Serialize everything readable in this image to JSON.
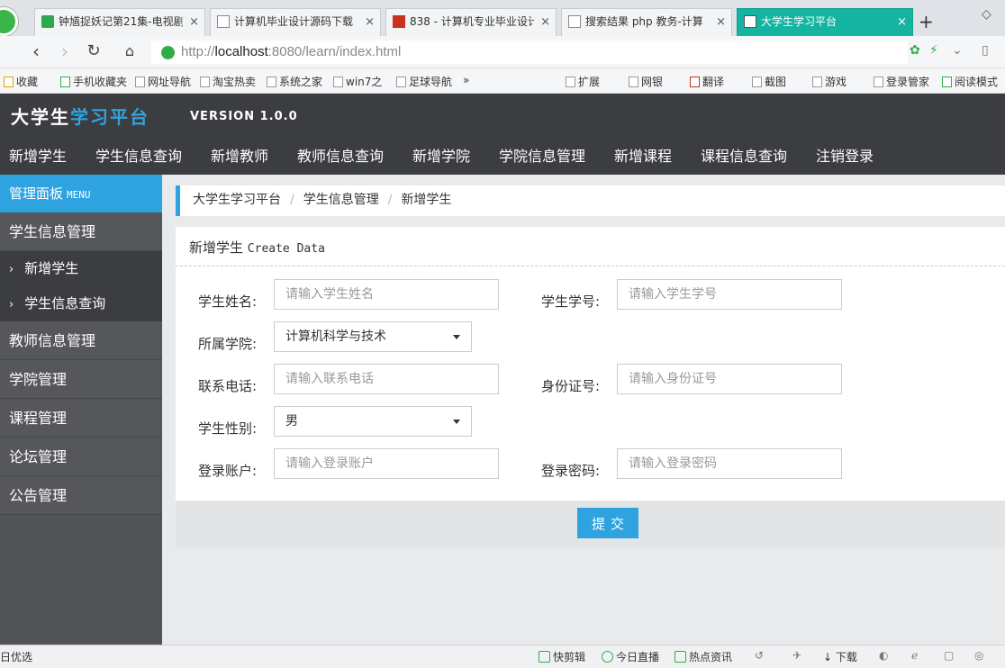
{
  "browser": {
    "tabs": [
      {
        "title": "钟馗捉妖记第21集-电视剧",
        "icon": "video-icon",
        "active": false
      },
      {
        "title": "计算机毕业设计源码下载",
        "icon": "page-icon",
        "active": false
      },
      {
        "title": "838 - 计算机专业毕业设计",
        "icon": "red-icon",
        "active": false
      },
      {
        "title": "搜索结果 php 教务-计算",
        "icon": "page-icon",
        "active": false
      },
      {
        "title": "大学生学习平台",
        "icon": "image-icon",
        "active": true
      }
    ],
    "tab_close": "×",
    "new_tab": "+",
    "url_prefix": "http://",
    "url_host": "localhost",
    "url_rest": ":8080/learn/index.html",
    "bookmarks": [
      "收藏",
      "手机收藏夹",
      "网址导航",
      "淘宝热卖",
      "系统之家",
      "win7之",
      "足球导航"
    ],
    "bookmarks_more": "»",
    "toolbar_right": [
      "扩展",
      "网银",
      "翻译",
      "截图",
      "游戏",
      "登录管家",
      "阅读模式"
    ],
    "status_left": "日优选",
    "status_right": [
      "快剪辑",
      "今日直播",
      "热点资讯",
      "下载"
    ]
  },
  "app": {
    "logo_main": "大学生",
    "logo_accent": "学习平台",
    "version": "VERSION 1.0.0",
    "top_nav": [
      "新增学生",
      "学生信息查询",
      "新增教师",
      "教师信息查询",
      "新增学院",
      "学院信息管理",
      "新增课程",
      "课程信息查询",
      "注销登录"
    ],
    "sidebar": {
      "header": "管理面板",
      "header_en": "MENU",
      "groups": [
        {
          "label": "学生信息管理",
          "sub": [
            "新增学生",
            "学生信息查询"
          ]
        },
        {
          "label": "教师信息管理"
        },
        {
          "label": "学院管理"
        },
        {
          "label": "课程管理"
        },
        {
          "label": "论坛管理"
        },
        {
          "label": "公告管理"
        }
      ]
    },
    "breadcrumb": [
      "大学生学习平台",
      "学生信息管理",
      "新增学生"
    ],
    "breadcrumb_sep": "/",
    "panel_title": "新增学生",
    "panel_title_en": "Create Data",
    "form": {
      "name_label": "学生姓名:",
      "name_placeholder": "请输入学生姓名",
      "number_label": "学生学号:",
      "number_placeholder": "请输入学生学号",
      "college_label": "所属学院:",
      "college_value": "计算机科学与技术",
      "phone_label": "联系电话:",
      "phone_placeholder": "请输入联系电话",
      "id_label": "身份证号:",
      "id_placeholder": "请输入身份证号",
      "gender_label": "学生性别:",
      "gender_value": "男",
      "account_label": "登录账户:",
      "account_placeholder": "请输入登录账户",
      "password_label": "登录密码:",
      "password_placeholder": "请输入登录密码",
      "submit": "提交"
    }
  },
  "colors": {
    "accent": "#2fa3df",
    "header_bg": "#3c3d40",
    "sidebar_bg": "#525357",
    "active_tab": "#15b4a0"
  }
}
